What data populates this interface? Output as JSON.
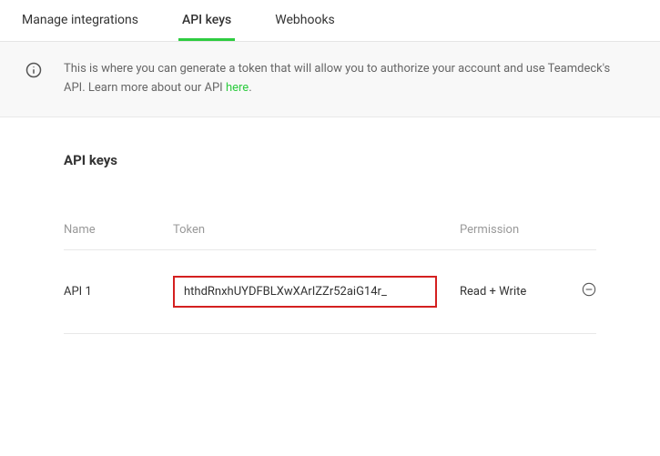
{
  "tabs": [
    {
      "label": "Manage integrations",
      "active": false
    },
    {
      "label": "API keys",
      "active": true
    },
    {
      "label": "Webhooks",
      "active": false
    }
  ],
  "banner": {
    "text_before_link": "This is where you can generate a token that will allow you to authorize your account and use Teamdeck's API. Learn more about our API ",
    "link_text": "here",
    "text_after_link": "."
  },
  "section_title": "API keys",
  "columns": {
    "name": "Name",
    "token": "Token",
    "permission": "Permission"
  },
  "rows": [
    {
      "name": "API 1",
      "token": "hthdRnxhUYDFBLXwXArIZZr52aiG14r_",
      "permission": "Read + Write"
    }
  ]
}
